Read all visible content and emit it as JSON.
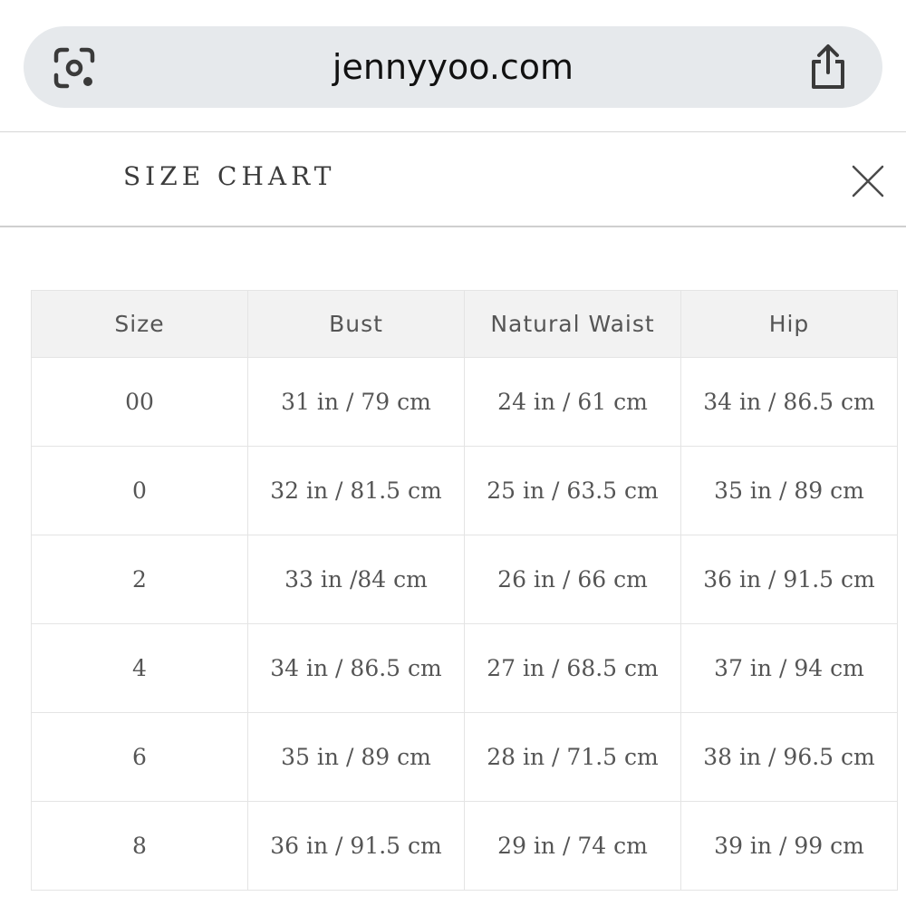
{
  "browser": {
    "url": "jennyyoo.com",
    "lens_icon": "google-lens-icon",
    "share_icon": "share-icon"
  },
  "modal": {
    "title": "SIZE CHART",
    "close_icon": "close-icon"
  },
  "table": {
    "headers": [
      "Size",
      "Bust",
      "Natural Waist",
      "Hip"
    ],
    "rows": [
      [
        "00",
        "31 in / 79 cm",
        "24 in / 61 cm",
        "34 in / 86.5 cm"
      ],
      [
        "0",
        "32 in / 81.5 cm",
        "25 in / 63.5 cm",
        "35 in / 89 cm"
      ],
      [
        "2",
        "33 in /84 cm",
        "26 in / 66 cm",
        "36 in / 91.5 cm"
      ],
      [
        "4",
        "34 in / 86.5 cm",
        "27 in / 68.5 cm",
        "37 in / 94 cm"
      ],
      [
        "6",
        "35 in / 89 cm",
        "28 in / 71.5 cm",
        "38 in / 96.5 cm"
      ],
      [
        "8",
        "36 in / 91.5 cm",
        "29 in / 74 cm",
        "39 in / 99 cm"
      ]
    ]
  }
}
